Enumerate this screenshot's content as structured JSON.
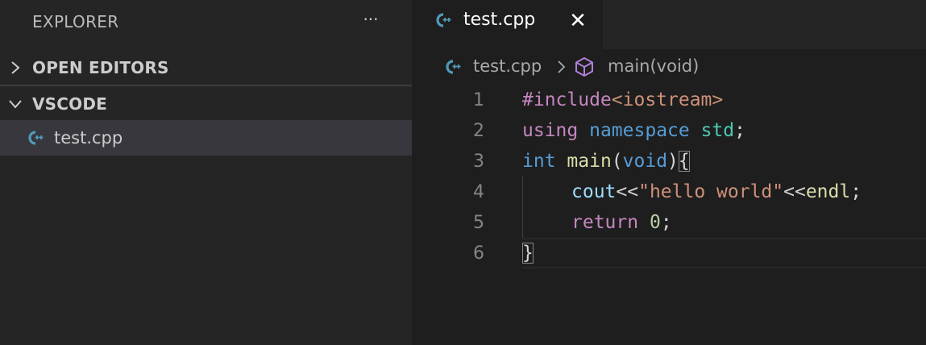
{
  "sidebar": {
    "title": "EXPLORER",
    "more_label": "···",
    "sections": [
      {
        "label": "OPEN EDITORS",
        "expanded": false
      },
      {
        "label": "VSCODE",
        "expanded": true
      }
    ],
    "files": [
      {
        "name": "test.cpp",
        "icon": "cpp-file-icon",
        "selected": true
      }
    ]
  },
  "editor": {
    "tab": {
      "label": "test.cpp",
      "icon": "cpp-file-icon",
      "close_label": "✕"
    },
    "breadcrumb": {
      "file": "test.cpp",
      "symbol": "main(void)",
      "symbol_icon": "method-cube-icon"
    },
    "line_numbers": [
      "1",
      "2",
      "3",
      "4",
      "5",
      "6"
    ],
    "lines": [
      [
        {
          "t": "#include",
          "c": "k-pre"
        },
        {
          "t": "<iostream>",
          "c": "k-inc"
        }
      ],
      [
        {
          "t": "using",
          "c": "k-ctl"
        },
        {
          "t": " ",
          "c": "k-pl"
        },
        {
          "t": "namespace",
          "c": "k-kw"
        },
        {
          "t": " ",
          "c": "k-pl"
        },
        {
          "t": "std",
          "c": "k-ns"
        },
        {
          "t": ";",
          "c": "k-pl"
        }
      ],
      [
        {
          "t": "int",
          "c": "k-kw"
        },
        {
          "t": " ",
          "c": "k-pl"
        },
        {
          "t": "main",
          "c": "k-fn"
        },
        {
          "t": "(",
          "c": "k-pl"
        },
        {
          "t": "void",
          "c": "k-kw"
        },
        {
          "t": ")",
          "c": "k-pl"
        },
        {
          "t": "{",
          "c": "k-pl bm"
        }
      ],
      [
        {
          "t": "    ",
          "c": "ind"
        },
        {
          "t": "cout",
          "c": "k-var"
        },
        {
          "t": "<<",
          "c": "k-pl"
        },
        {
          "t": "\"hello world\"",
          "c": "k-str"
        },
        {
          "t": "<<",
          "c": "k-pl"
        },
        {
          "t": "endl",
          "c": "k-fn"
        },
        {
          "t": ";",
          "c": "k-pl"
        }
      ],
      [
        {
          "t": "    ",
          "c": "ind"
        },
        {
          "t": "return",
          "c": "k-ctl"
        },
        {
          "t": " ",
          "c": "k-pl"
        },
        {
          "t": "0",
          "c": "k-num"
        },
        {
          "t": ";",
          "c": "k-pl"
        }
      ],
      [
        {
          "t": "}",
          "c": "k-pl bm"
        }
      ]
    ]
  },
  "colors": {
    "sidebar_bg": "#252526",
    "editor_bg": "#1e1e1e",
    "selected_row_bg": "#37373d",
    "cpp_icon": "#519aba",
    "symbol_icon": "#b180d7"
  }
}
